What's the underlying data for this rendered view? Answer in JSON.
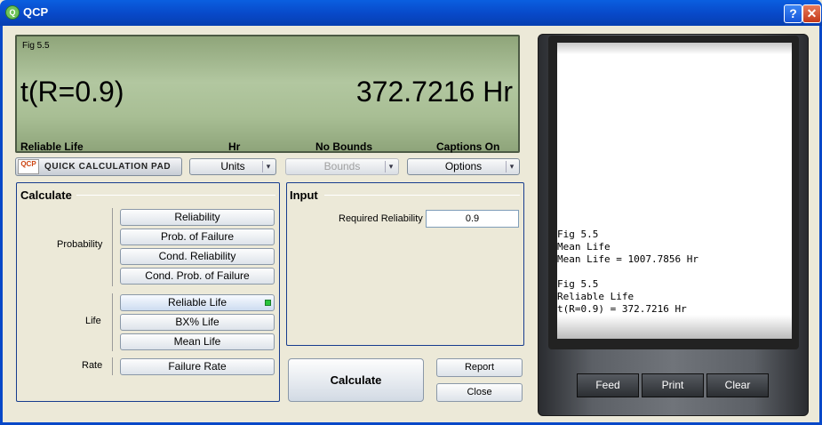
{
  "window": {
    "title": "QCP",
    "help_glyph": "?",
    "close_glyph": "✕"
  },
  "lcd": {
    "fig": "Fig 5.5",
    "expression": "t(R=0.9)",
    "value": "372.7216 Hr",
    "status": [
      "Reliable Life",
      "Hr",
      "No Bounds",
      "Captions On"
    ]
  },
  "toolbar": {
    "qcp_logo": "QCP",
    "qcp_label": "QUICK CALCULATION PAD",
    "units": "Units",
    "bounds": "Bounds",
    "options": "Options",
    "chevron": "▾"
  },
  "calculate": {
    "title": "Calculate",
    "probability_label": "Probability",
    "life_label": "Life",
    "rate_label": "Rate",
    "probability_buttons": [
      "Reliability",
      "Prob. of Failure",
      "Cond. Reliability",
      "Cond. Prob. of Failure"
    ],
    "life_buttons": [
      "Reliable Life",
      "BX% Life",
      "Mean Life"
    ],
    "rate_buttons": [
      "Failure Rate"
    ]
  },
  "input": {
    "title": "Input",
    "required_reliability_label": "Required Reliability",
    "required_reliability_value": "0.9"
  },
  "actions": {
    "calculate": "Calculate",
    "report": "Report",
    "close": "Close"
  },
  "printer": {
    "lines": [
      "Fig 5.5",
      "Mean Life",
      "Mean Life = 1007.7856 Hr",
      "",
      "Fig 5.5",
      "Reliable Life",
      "t(R=0.9) = 372.7216 Hr"
    ],
    "feed": "Feed",
    "print": "Print",
    "clear": "Clear"
  },
  "colors": {
    "title_bar": "#0848c8",
    "lcd": "#b2c7a0",
    "panel_border": "#173c8e",
    "led": "#29c43c"
  }
}
